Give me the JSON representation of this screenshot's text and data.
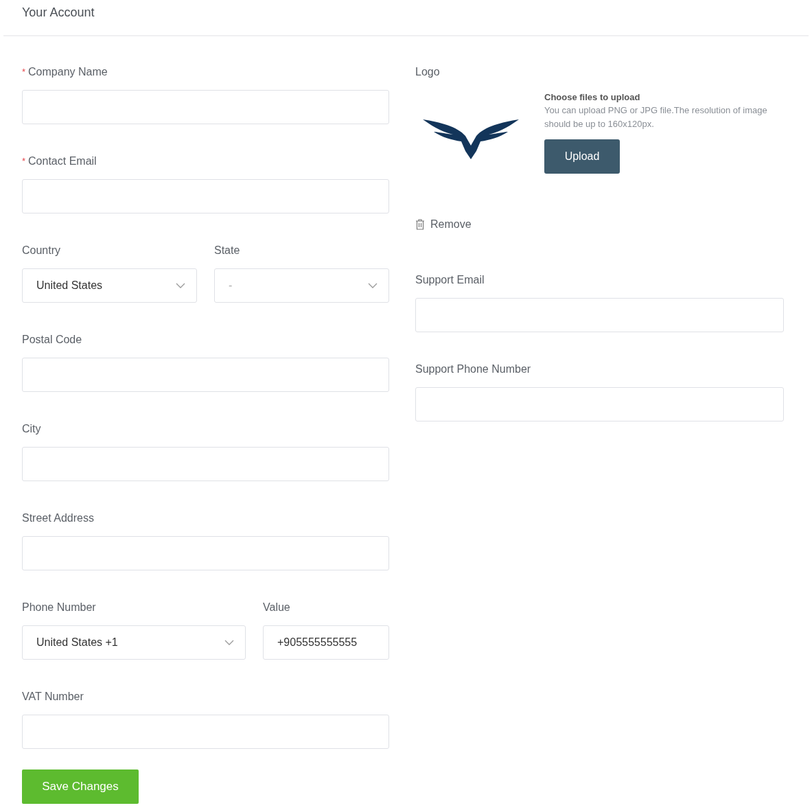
{
  "header": {
    "title": "Your Account"
  },
  "left_rows": [
    {
      "kind": "single",
      "fields": [
        {
          "required_mark": "*",
          "label": "Company Name",
          "kind": "text"
        }
      ]
    },
    {
      "kind": "single",
      "fields": [
        {
          "required_mark": "*",
          "label": "Contact Email",
          "kind": "text"
        }
      ]
    },
    {
      "kind": "even",
      "fields": [
        {
          "label": "Country",
          "kind": "select",
          "value": "United States"
        },
        {
          "label": "State",
          "kind": "select",
          "placeholder": "-"
        }
      ]
    },
    {
      "kind": "single",
      "fields": [
        {
          "label": "Postal Code",
          "kind": "text"
        }
      ]
    },
    {
      "kind": "single",
      "fields": [
        {
          "label": "City",
          "kind": "text"
        }
      ]
    },
    {
      "kind": "single",
      "fields": [
        {
          "label": "Street Address",
          "kind": "text"
        }
      ]
    },
    {
      "kind": "wide-first",
      "fields": [
        {
          "label": "Phone Number",
          "kind": "select",
          "value": "United States +1"
        },
        {
          "label": "Value",
          "kind": "text",
          "value": "+905555555555"
        }
      ]
    },
    {
      "kind": "single",
      "fields": [
        {
          "label": "VAT Number",
          "kind": "text"
        }
      ]
    }
  ],
  "save_button": "Save Changes",
  "logo": {
    "label": "Logo",
    "upload_title": "Choose files to upload",
    "upload_hint": "You can upload PNG or JPG file.The resolution of image should be up to 160x120px.",
    "upload_button": "Upload",
    "remove": "Remove"
  },
  "right_fields": [
    {
      "label": "Support Email"
    },
    {
      "label": "Support Phone Number"
    }
  ]
}
